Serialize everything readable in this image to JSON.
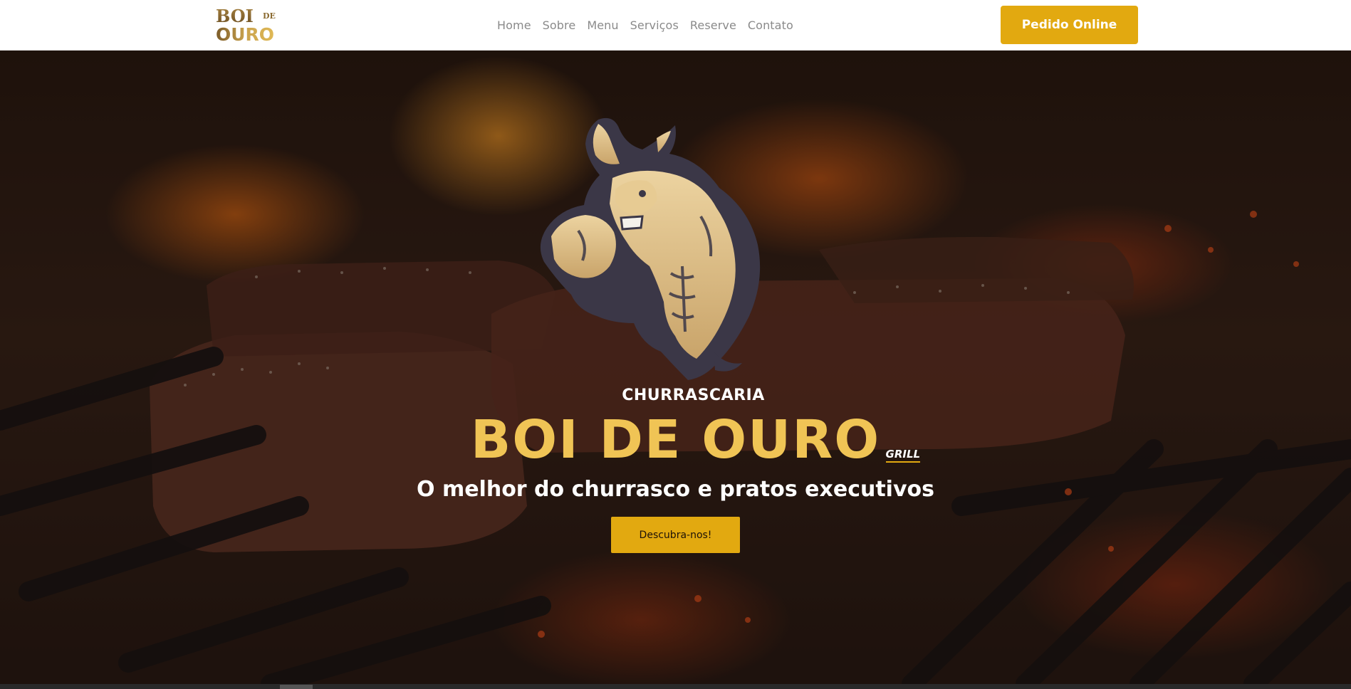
{
  "nav": {
    "logo_line1": "BOI",
    "logo_de": "DE",
    "logo_line2": "OURO",
    "links": [
      {
        "label": "Home"
      },
      {
        "label": "Sobre"
      },
      {
        "label": "Menu"
      },
      {
        "label": "Serviços"
      },
      {
        "label": "Reserve"
      },
      {
        "label": "Contato"
      }
    ],
    "order_button": "Pedido Online"
  },
  "hero": {
    "eyebrow": "CHURRASCARIA",
    "title": "BOI DE OURO",
    "grill": "GRILL",
    "subtitle": "O melhor do churrasco e pratos executivos",
    "cta": "Descubra-nos!",
    "mascot_icon": "muscular-bull-mascot-icon",
    "background": "grilled-steaks-over-fire-image"
  },
  "colors": {
    "accent": "#e2a910",
    "title_gold": "#f0c455",
    "nav_text": "#8a8a8a",
    "nav_bg": "#ffffff"
  }
}
